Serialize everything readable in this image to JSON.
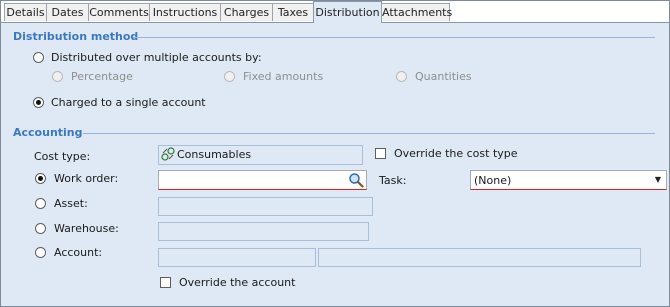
{
  "tabs": [
    {
      "label": "Details"
    },
    {
      "label": "Dates"
    },
    {
      "label": "Comments"
    },
    {
      "label": "Instructions"
    },
    {
      "label": "Charges"
    },
    {
      "label": "Taxes"
    },
    {
      "label": "Distribution"
    },
    {
      "label": "Attachments"
    }
  ],
  "active_tab": "Distribution",
  "distribution": {
    "title": "Distribution method",
    "multiple_label": "Distributed over multiple accounts by:",
    "percentage_label": "Percentage",
    "fixed_label": "Fixed amounts",
    "quantities_label": "Quantities",
    "single_label": "Charged to a single account"
  },
  "accounting": {
    "title": "Accounting",
    "cost_type_label": "Cost type:",
    "cost_type_value": "Consumables",
    "override_cost_type_label": "Override the cost type",
    "work_order_label": "Work order:",
    "work_order_value": "",
    "task_label": "Task:",
    "task_value": "(None)",
    "asset_label": "Asset:",
    "warehouse_label": "Warehouse:",
    "account_label": "Account:",
    "override_account_label": "Override the account"
  },
  "colors": {
    "section_title": "#3c78c2",
    "panel_bg": "#dfe9f5",
    "required_border": "#e02020"
  }
}
